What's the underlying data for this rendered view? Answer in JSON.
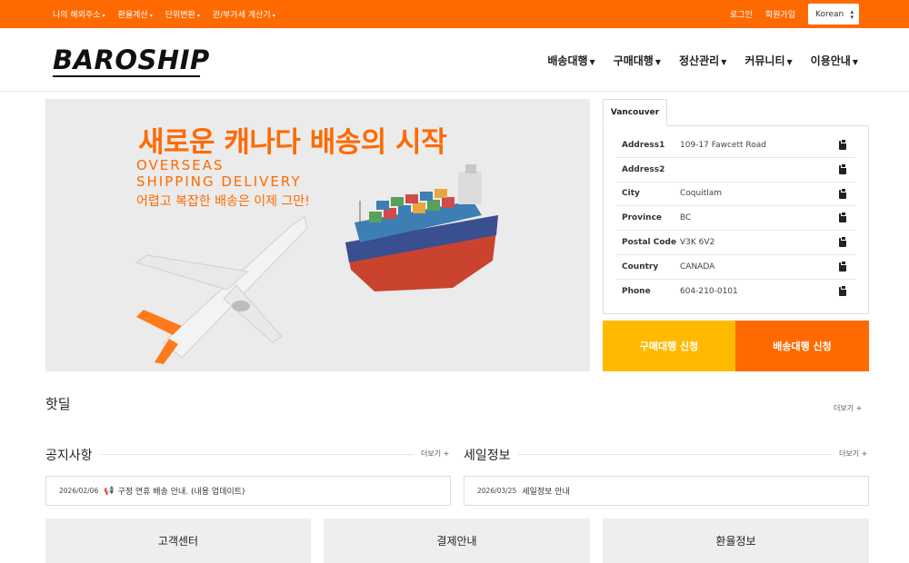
{
  "topbar": {
    "nav": [
      {
        "label": "나의 해외주소"
      },
      {
        "label": "환율계산"
      },
      {
        "label": "단위변환"
      },
      {
        "label": "관/부가세 계산기"
      }
    ],
    "login": "로그인",
    "signup": "회원가입",
    "language": "Korean",
    "color": "#ff6a00"
  },
  "header": {
    "logo": "BAROSHIP",
    "nav": [
      {
        "label": "배송대행"
      },
      {
        "label": "구매대행"
      },
      {
        "label": "정산관리"
      },
      {
        "label": "커뮤니티"
      },
      {
        "label": "이용안내"
      }
    ]
  },
  "banner": {
    "headline": "새로운 캐나다 배송의 시작",
    "sub1": "OVERSEAS",
    "sub2": "SHIPPING DELIVERY",
    "sub3": "어렵고 복잡한 배송은 이제 그만!"
  },
  "address": {
    "tab": "Vancouver",
    "rows": [
      {
        "label": "Address1",
        "value": "109-17 Fawcett Road"
      },
      {
        "label": "Address2",
        "value": ""
      },
      {
        "label": "City",
        "value": "Coquitlam"
      },
      {
        "label": "Province",
        "value": "BC"
      },
      {
        "label": "Postal Code",
        "value": "V3K 6V2"
      },
      {
        "label": "Country",
        "value": "CANADA"
      },
      {
        "label": "Phone",
        "value": "604-210-0101"
      }
    ],
    "copy_icon": "clipboard-icon"
  },
  "buttons": {
    "buy": "구매대행 신청",
    "ship": "배송대행 신청",
    "buy_color": "#ffba00",
    "ship_color": "#ff6a00"
  },
  "hotdeal": {
    "title": "핫딜",
    "more": "더보기 +"
  },
  "notice": {
    "title": "공지사항",
    "more": "더보기 +",
    "date": "2026/02/06",
    "text": "구정 연휴 배송 안내. (내용 업데이트)",
    "icon": "megaphone-icon"
  },
  "sale": {
    "title": "세일정보",
    "more": "더보기 +",
    "date": "2026/03/25",
    "text": "세일정보 안내"
  },
  "cards": [
    {
      "label": "고객센터"
    },
    {
      "label": "결제안내"
    },
    {
      "label": "환율정보"
    }
  ]
}
